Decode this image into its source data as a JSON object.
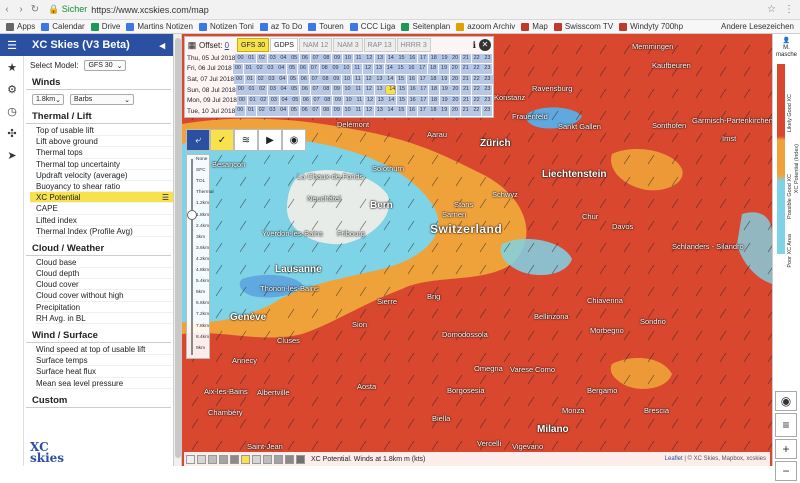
{
  "browser": {
    "secure_label": "Sicher",
    "url": "https://www.xcskies.com/map",
    "bookmarks": [
      {
        "label": "Apps",
        "color": "#666666"
      },
      {
        "label": "Calendar",
        "color": "#3b78e7"
      },
      {
        "label": "Drive",
        "color": "#1a9a55"
      },
      {
        "label": "Martins Notizen",
        "color": "#3b78e7"
      },
      {
        "label": "Notizen Toni",
        "color": "#3b78e7"
      },
      {
        "label": "az To Do",
        "color": "#3b78e7"
      },
      {
        "label": "Touren",
        "color": "#3b78e7"
      },
      {
        "label": "CCC Liga",
        "color": "#3b78e7"
      },
      {
        "label": "Seitenplan",
        "color": "#1a9a55"
      },
      {
        "label": "azoom Archiv",
        "color": "#e0a000"
      },
      {
        "label": "Map",
        "color": "#c0392b"
      },
      {
        "label": "Swisscom TV",
        "color": "#c0392b"
      },
      {
        "label": "Windyty 700hp",
        "color": "#c0392b"
      }
    ],
    "other_bookmarks": "Andere Lesezeichen"
  },
  "panel": {
    "title": "XC Skies (V3 Beta)",
    "select_model_label": "Select Model:",
    "model_value": "GFS 30",
    "winds_title": "Winds",
    "winds_alt_value": "1.8km",
    "winds_style_value": "Barbs",
    "sections": [
      {
        "title": "Thermal / Lift",
        "items": [
          "Top of usable lift",
          "Lift above ground",
          "Thermal tops",
          "Thermal top uncertainty",
          "Updraft velocity (average)",
          "Buoyancy to shear ratio",
          "XC Potential",
          "CAPE",
          "Lifted index",
          "Thermal Index (Profile Avg)"
        ]
      },
      {
        "title": "Cloud / Weather",
        "items": [
          "Cloud base",
          "Cloud depth",
          "Cloud cover",
          "Cloud cover without high",
          "Precipitation",
          "RH Avg. in BL"
        ]
      },
      {
        "title": "Wind / Surface",
        "items": [
          "Wind speed at top of usable lift",
          "Surface temps",
          "Surface heat flux",
          "Mean sea level pressure"
        ]
      },
      {
        "title": "Custom",
        "items": []
      }
    ],
    "active_item": "XC Potential",
    "logo_line1": "XC",
    "logo_line2": "skies"
  },
  "timetable": {
    "offset_label": "Offset:",
    "offset_value": "0",
    "models": [
      {
        "label": "GFS 30",
        "state": "active"
      },
      {
        "label": "GDPS",
        "state": "plain"
      },
      {
        "label": "NAM 12",
        "state": "disabled"
      },
      {
        "label": "NAM 3",
        "state": "disabled"
      },
      {
        "label": "RAP 13",
        "state": "disabled"
      },
      {
        "label": "HRRR 3",
        "state": "disabled"
      }
    ],
    "days": [
      "Thu, 05 Jul 2018",
      "Fri, 06 Jul 2018",
      "Sat, 07 Jul 2018",
      "Sun, 08 Jul 2018",
      "Mon, 09 Jul 2018",
      "Tue, 10 Jul 2018"
    ],
    "hours": [
      "00",
      "01",
      "02",
      "03",
      "04",
      "05",
      "06",
      "07",
      "08",
      "09",
      "10",
      "11",
      "12",
      "13",
      "14",
      "15",
      "16",
      "17",
      "18",
      "19",
      "20",
      "21",
      "22",
      "23"
    ],
    "selected_day_index": 3,
    "selected_hour": "14"
  },
  "slider": {
    "labels": [
      "None",
      "SFC",
      "TOL",
      "Thermal",
      "1.2km",
      "1.8km",
      "2.4km",
      "3km",
      "3.6km",
      "4.2km",
      "4.8km",
      "5.4km",
      "6km",
      "6.6km",
      "7.2km",
      "7.8km",
      "8.4km",
      "9km"
    ]
  },
  "map_labels": [
    {
      "text": "Memmingen",
      "cls": ""
    },
    {
      "text": "Kaufbeuren",
      "cls": ""
    },
    {
      "text": "Ravensburg",
      "cls": ""
    },
    {
      "text": "Konstanz",
      "cls": ""
    },
    {
      "text": "Frauenfeld",
      "cls": ""
    },
    {
      "text": "Sankt Gallen",
      "cls": ""
    },
    {
      "text": "Sonthofen",
      "cls": ""
    },
    {
      "text": "Garmisch-Partenkirchen",
      "cls": ""
    },
    {
      "text": "Imst",
      "cls": ""
    },
    {
      "text": "Delémont",
      "cls": ""
    },
    {
      "text": "Aarau",
      "cls": ""
    },
    {
      "text": "Zürich",
      "cls": "big"
    },
    {
      "text": "Besançon",
      "cls": ""
    },
    {
      "text": "Solothurn",
      "cls": ""
    },
    {
      "text": "La Chaux-de-Fonds",
      "cls": ""
    },
    {
      "text": "Neuchâtel",
      "cls": ""
    },
    {
      "text": "Liechtenstein",
      "cls": "big"
    },
    {
      "text": "Schwyz",
      "cls": ""
    },
    {
      "text": "Bern",
      "cls": "big"
    },
    {
      "text": "Stans",
      "cls": ""
    },
    {
      "text": "Sarnen",
      "cls": ""
    },
    {
      "text": "Chur",
      "cls": ""
    },
    {
      "text": "Davos",
      "cls": ""
    },
    {
      "text": "Switzerland",
      "cls": "country"
    },
    {
      "text": "Yverdon-les-Bains",
      "cls": ""
    },
    {
      "text": "Fribourg",
      "cls": ""
    },
    {
      "text": "Schlanders - Silandro",
      "cls": ""
    },
    {
      "text": "Lausanne",
      "cls": "big"
    },
    {
      "text": "Thonon-les-Bains",
      "cls": ""
    },
    {
      "text": "Genève",
      "cls": "big"
    },
    {
      "text": "Sierre",
      "cls": ""
    },
    {
      "text": "Brig",
      "cls": ""
    },
    {
      "text": "Chiavenna",
      "cls": ""
    },
    {
      "text": "Sion",
      "cls": ""
    },
    {
      "text": "Bellinzona",
      "cls": ""
    },
    {
      "text": "Sondrio",
      "cls": ""
    },
    {
      "text": "Morbegno",
      "cls": ""
    },
    {
      "text": "Cluses",
      "cls": ""
    },
    {
      "text": "Domodossola",
      "cls": ""
    },
    {
      "text": "Annecy",
      "cls": ""
    },
    {
      "text": "Omegna",
      "cls": ""
    },
    {
      "text": "Varese",
      "cls": ""
    },
    {
      "text": "Como",
      "cls": ""
    },
    {
      "text": "Aix-les-Bains",
      "cls": ""
    },
    {
      "text": "Albertville",
      "cls": ""
    },
    {
      "text": "Aosta",
      "cls": ""
    },
    {
      "text": "Borgosesia",
      "cls": ""
    },
    {
      "text": "Bergamo",
      "cls": ""
    },
    {
      "text": "Chambéry",
      "cls": ""
    },
    {
      "text": "Biella",
      "cls": ""
    },
    {
      "text": "Monza",
      "cls": ""
    },
    {
      "text": "Brescia",
      "cls": ""
    },
    {
      "text": "Milano",
      "cls": "big"
    },
    {
      "text": "Vercelli",
      "cls": ""
    },
    {
      "text": "Vigevano",
      "cls": ""
    },
    {
      "text": "Saint-Jean",
      "cls": ""
    }
  ],
  "legend": {
    "user_short": "M.",
    "user_name": "masche",
    "label_likely": "Likely Good XC",
    "label_potential": "XC Potential (Index)",
    "label_possible": "Possible Good XC",
    "label_poor": "Poor XC Area",
    "colors": {
      "likely": "#d9472f",
      "potential": "#f0a23a",
      "possible": "#7fd3e6"
    }
  },
  "bottom": {
    "caption": "XC Potential. Winds at 1.8km m (kts)",
    "attribution_leaflet": "Leaflet",
    "attribution_rest": " | © XC Skies, Mapbox, xcskies",
    "swatches": [
      "#eeeeee",
      "#d6d6d6",
      "#bdbdbd",
      "#a3a3a3",
      "#8a8a8a",
      "#f7e24e",
      "#d6d6d6",
      "#bdbdbd",
      "#a3a3a3",
      "#8a8a8a",
      "#707070"
    ]
  },
  "colors": {
    "brand": "#2b4fa1",
    "highlight": "#f7e24e",
    "map_red": "#d9472f",
    "map_orange": "#f0a23a",
    "map_blue": "#7fd3e6"
  }
}
